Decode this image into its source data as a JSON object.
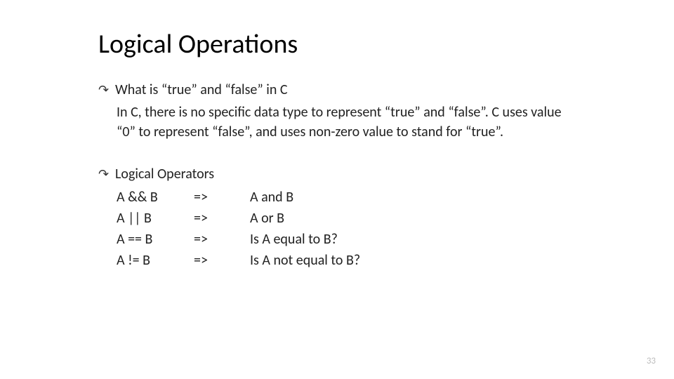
{
  "title": "Logical Operations",
  "section1": {
    "heading": "What is “true” and “false” in C",
    "body": "In C, there is no specific data type to represent “true” and “false”. C uses value “0” to represent “false”, and uses non-zero value to stand for “true”."
  },
  "section2": {
    "heading": "Logical Operators",
    "rows": [
      {
        "expr": "A && B",
        "arrow": "=>",
        "desc": "A and B"
      },
      {
        "expr": "A || B",
        "arrow": "=>",
        "desc": "A  or  B"
      },
      {
        "expr": "A == B",
        "arrow": "=>",
        "desc": "Is A equal to B?"
      },
      {
        "expr": "A != B",
        "arrow": "=>",
        "desc": "Is A not equal to B?"
      }
    ]
  },
  "pageNumber": "33",
  "bulletGlyph": "↷"
}
